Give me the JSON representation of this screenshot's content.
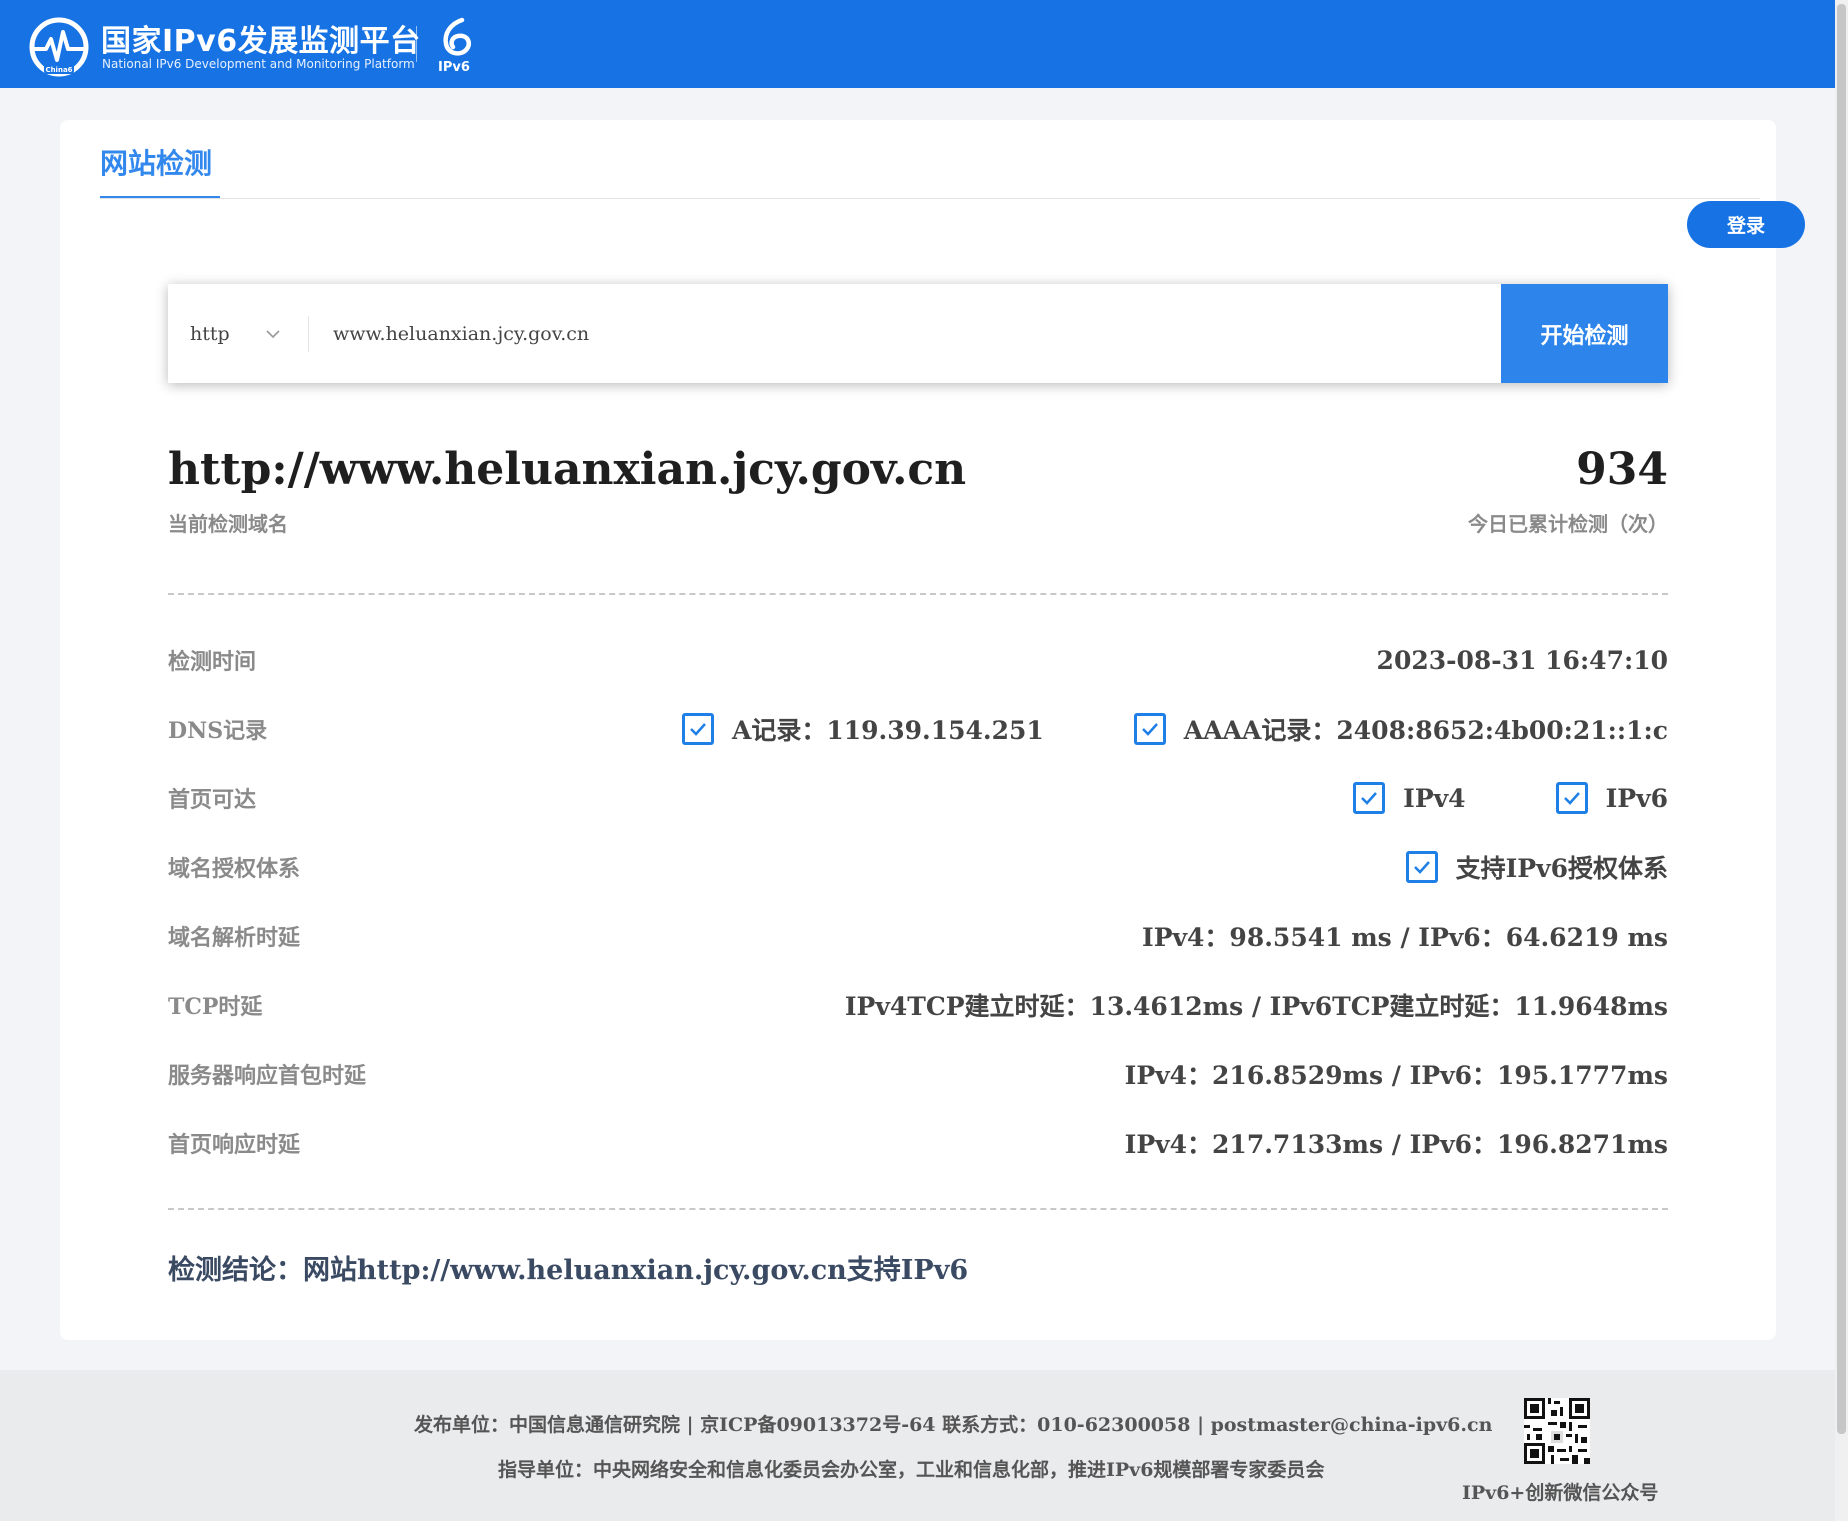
{
  "brand": {
    "title": "国家IPv6发展监测平台",
    "subtitle": "National IPv6 Development and Monitoring Platform",
    "ipv6_badge": "IPv6",
    "logo_icon": "heartbeat-globe-icon",
    "ipv6_icon": "ipv6-swirl-icon",
    "primary_color": "#1773e4"
  },
  "tab": {
    "label": "网站检测"
  },
  "login_label": "登录",
  "search": {
    "protocol": "http",
    "value": "www.heluanxian.jcy.gov.cn",
    "button": "开始检测"
  },
  "result": {
    "domain": "http://www.heluanxian.jcy.gov.cn",
    "domain_label": "当前检测域名",
    "count": "934",
    "count_label": "今日已累计检测（次）"
  },
  "rows": [
    {
      "label": "检测时间",
      "value": "2023-08-31 16:47:10"
    },
    {
      "label": "DNS记录",
      "checks": [
        "A记录：119.39.154.251",
        "AAAA记录：2408:8652:4b00:21::1:c"
      ]
    },
    {
      "label": "首页可达",
      "checks": [
        "IPv4",
        "IPv6"
      ]
    },
    {
      "label": "域名授权体系",
      "checks": [
        "支持IPv6授权体系"
      ]
    },
    {
      "label": "域名解析时延",
      "value": "IPv4：98.5541 ms / IPv6：64.6219 ms"
    },
    {
      "label": "TCP时延",
      "value": "IPv4TCP建立时延：13.4612ms / IPv6TCP建立时延：11.9648ms"
    },
    {
      "label": "服务器响应首包时延",
      "value": "IPv4：216.8529ms / IPv6：195.1777ms"
    },
    {
      "label": "首页响应时延",
      "value": "IPv4：217.7133ms / IPv6：196.8271ms"
    }
  ],
  "conclusion": "检测结论：网站http://www.heluanxian.jcy.gov.cn支持IPv6",
  "footer": {
    "line1": "发布单位：中国信息通信研究院 | 京ICP备09013372号-64 联系方式：010-62300058 | postmaster@china-ipv6.cn",
    "line2": "指导单位：中央网络安全和信息化委员会办公室，工业和信息化部，推进IPv6规模部署专家委员会",
    "qr_caption": "IPv6+创新微信公众号",
    "qr_icon": "qr-code-icon"
  }
}
